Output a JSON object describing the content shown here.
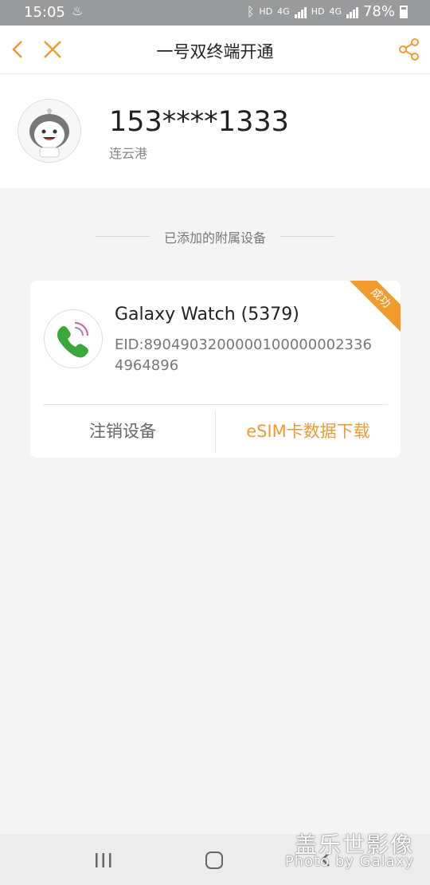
{
  "status": {
    "time": "15:05",
    "battery": "78%",
    "hd1": "HD",
    "hd2": "HD",
    "net1": "4G",
    "net2": "4G"
  },
  "header": {
    "title": "一号双终端开通"
  },
  "profile": {
    "phone": "153****1333",
    "city": "连云港"
  },
  "section": {
    "title": "已添加的附属设备"
  },
  "device": {
    "badge": "成功",
    "name": "Galaxy Watch (5379)",
    "eid": "EID:8904903200000100000002336 4964896",
    "deregister_label": "注销设备",
    "download_label": "eSIM卡数据下载"
  },
  "watermark": {
    "line1": "盖乐世影像",
    "line2": "Photo by Galaxy"
  },
  "colors": {
    "accent": "#f39a2f",
    "statusbar": "#999a9c"
  }
}
